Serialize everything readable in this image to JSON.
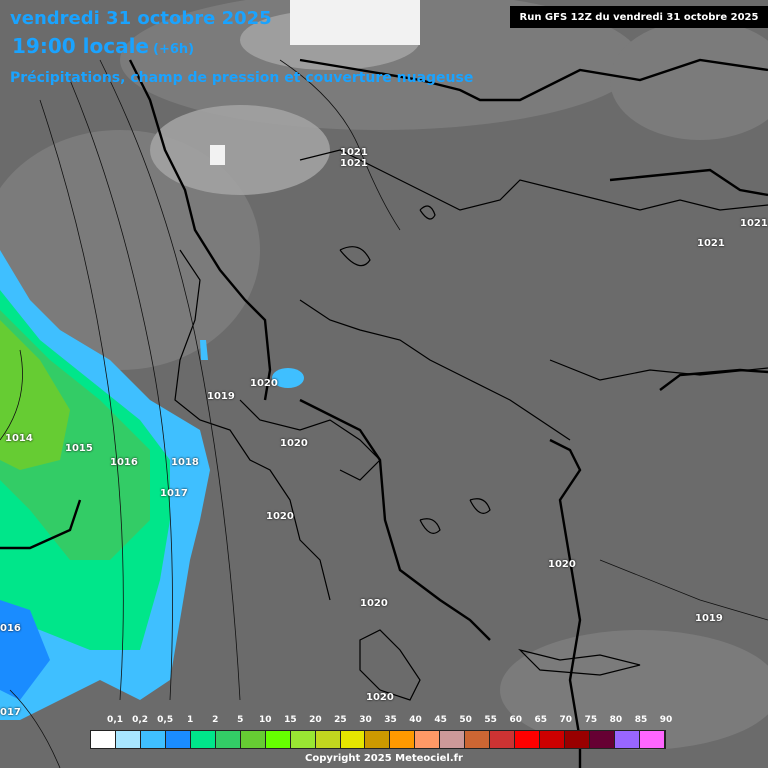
{
  "title": {
    "date": "vendredi 31 octobre 2025",
    "local_time": "19:00 locale",
    "offset": "(+6h)",
    "subtitle": "Précipitations, champ de pression et couverture nuageuse"
  },
  "run_info": "Run GFS 12Z du vendredi 31 octobre 2025",
  "copyright": "Copyright 2025 Meteociel.fr",
  "legend": {
    "labels": [
      "0,1",
      "0,2",
      "0,5",
      "1",
      "2",
      "5",
      "10",
      "15",
      "20",
      "25",
      "30",
      "35",
      "40",
      "45",
      "50",
      "55",
      "60",
      "65",
      "70",
      "75",
      "80",
      "85",
      "90"
    ],
    "colors": [
      "#ffffff",
      "#a8e6ff",
      "#3fbfff",
      "#1a8cff",
      "#00e68a",
      "#33cc66",
      "#66cc33",
      "#66ff00",
      "#99e633",
      "#c2d61f",
      "#e6e600",
      "#cc9900",
      "#ff9900",
      "#ff9966",
      "#cc9999",
      "#cc6633",
      "#cc3333",
      "#ff0000",
      "#cc0000",
      "#990000",
      "#660033",
      "#9966ff",
      "#ff66ff"
    ]
  },
  "isobars": [
    {
      "label": "1021"
    },
    {
      "label": "1021"
    },
    {
      "label": "1021"
    },
    {
      "label": "1021"
    },
    {
      "label": "1020"
    },
    {
      "label": "1019"
    },
    {
      "label": "1020"
    },
    {
      "label": "1014"
    },
    {
      "label": "1015"
    },
    {
      "label": "1016"
    },
    {
      "label": "1018"
    },
    {
      "label": "1017"
    },
    {
      "label": "1020"
    },
    {
      "label": "1020"
    },
    {
      "label": "1020"
    },
    {
      "label": "1020"
    },
    {
      "label": "1019"
    },
    {
      "label": "016"
    },
    {
      "label": "017"
    }
  ]
}
